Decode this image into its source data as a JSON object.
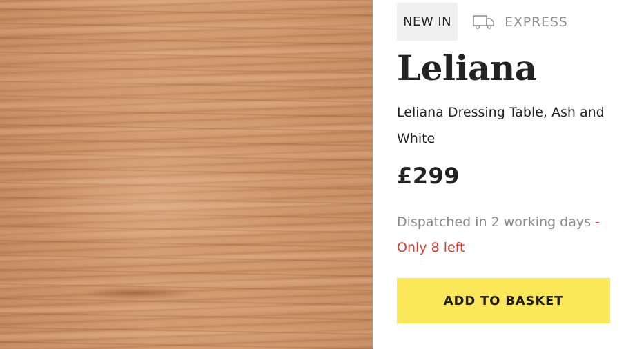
{
  "product": {
    "image_alt": "Ash wood grain texture",
    "badges": {
      "new_in": "NEW IN",
      "express": "EXPRESS"
    },
    "name": "Leliana",
    "description": "Leliana Dressing Table, Ash and White",
    "price": "£299",
    "dispatch": {
      "text": "Dispatched in 2 working days",
      "separator": " - ",
      "stock_warning": "Only 8 left"
    },
    "add_to_basket_label": "ADD TO BASKET"
  },
  "colors": {
    "accent_button": "#fbe858",
    "stock_warning": "#d83a2b",
    "muted_text": "#8a8a8a"
  },
  "icons": {
    "express": "delivery-truck-icon"
  }
}
